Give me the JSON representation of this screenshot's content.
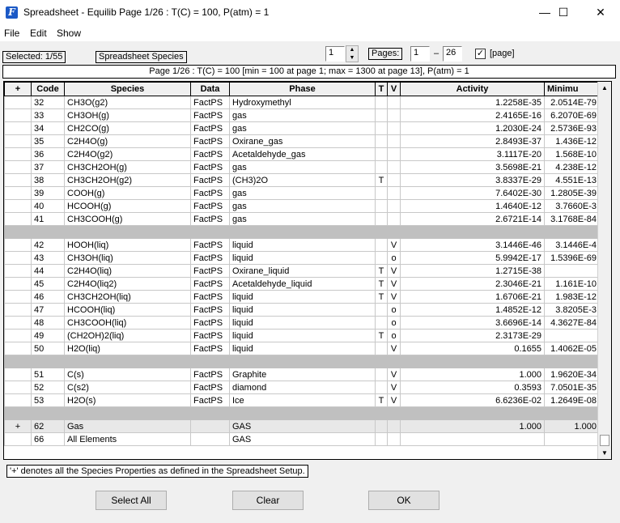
{
  "window": {
    "title": "Spreadsheet - Equilib   Page 1/26 : T(C) = 100,  P(atm) = 1",
    "minimize": "—",
    "maximize": "☐",
    "close": "✕"
  },
  "menu": [
    "File",
    "Edit",
    "Show"
  ],
  "toolbar": {
    "selected": "Selected: 1/55",
    "species_button": "Spreadsheet Species",
    "page_value": "1",
    "pages_label": "Pages:",
    "page_from": "1",
    "dash": "–",
    "page_to": "26",
    "page_check": "✓",
    "page_check_label": "[page]"
  },
  "info_bar": "Page 1/26 : T(C) = 100 [min = 100 at page  1; max = 1300 at page  13],  P(atm) = 1",
  "columns": [
    "+",
    "Code",
    "Species",
    "Data",
    "Phase",
    "T",
    "V",
    "Activity",
    "Minimu"
  ],
  "rows": [
    {
      "type": "row",
      "plus": "",
      "code": "32",
      "species": "CH3O(g2)",
      "data": "FactPS",
      "phase": "Hydroxymethyl",
      "t": "",
      "v": "",
      "activity": "1.2258E-35",
      "min": "2.0514E-79"
    },
    {
      "type": "row",
      "plus": "",
      "code": "33",
      "species": "CH3OH(g)",
      "data": "FactPS",
      "phase": "gas",
      "t": "",
      "v": "",
      "activity": "2.4165E-16",
      "min": "6.2070E-69"
    },
    {
      "type": "row",
      "plus": "",
      "code": "34",
      "species": "CH2CO(g)",
      "data": "FactPS",
      "phase": "gas",
      "t": "",
      "v": "",
      "activity": "1.2030E-24",
      "min": "2.5736E-93"
    },
    {
      "type": "row",
      "plus": "",
      "code": "35",
      "species": "C2H4O(g)",
      "data": "FactPS",
      "phase": "Oxirane_gas",
      "t": "",
      "v": "",
      "activity": "2.8493E-37",
      "min": "1.436E-12"
    },
    {
      "type": "row",
      "plus": "",
      "code": "36",
      "species": "C2H4O(g2)",
      "data": "FactPS",
      "phase": "Acetaldehyde_gas",
      "t": "",
      "v": "",
      "activity": "3.1117E-20",
      "min": "1.568E-10"
    },
    {
      "type": "row",
      "plus": "",
      "code": "37",
      "species": "CH3CH2OH(g)",
      "data": "FactPS",
      "phase": "gas",
      "t": "",
      "v": "",
      "activity": "3.5698E-21",
      "min": "4.238E-12"
    },
    {
      "type": "row",
      "plus": "",
      "code": "38",
      "species": "CH3CH2OH(g2)",
      "data": "FactPS",
      "phase": "(CH3)2O",
      "t": "T",
      "v": "",
      "activity": "3.8337E-29",
      "min": "4.551E-13"
    },
    {
      "type": "row",
      "plus": "",
      "code": "39",
      "species": "COOH(g)",
      "data": "FactPS",
      "phase": "gas",
      "t": "",
      "v": "",
      "activity": "7.6402E-30",
      "min": "1.2805E-39"
    },
    {
      "type": "row",
      "plus": "",
      "code": "40",
      "species": "HCOOH(g)",
      "data": "FactPS",
      "phase": "gas",
      "t": "",
      "v": "",
      "activity": "1.4640E-12",
      "min": "3.7660E-3"
    },
    {
      "type": "row",
      "plus": "",
      "code": "41",
      "species": "CH3COOH(g)",
      "data": "FactPS",
      "phase": "gas",
      "t": "",
      "v": "",
      "activity": "2.6721E-14",
      "min": "3.1768E-84"
    },
    {
      "type": "sep"
    },
    {
      "type": "row",
      "plus": "",
      "code": "42",
      "species": "HOOH(liq)",
      "data": "FactPS",
      "phase": "liquid",
      "t": "",
      "v": "V",
      "activity": "3.1446E-46",
      "min": "3.1446E-4"
    },
    {
      "type": "row",
      "plus": "",
      "code": "43",
      "species": "CH3OH(liq)",
      "data": "FactPS",
      "phase": "liquid",
      "t": "",
      "v": "o",
      "activity": "5.9942E-17",
      "min": "1.5396E-69"
    },
    {
      "type": "row",
      "plus": "",
      "code": "44",
      "species": "C2H4O(liq)",
      "data": "FactPS",
      "phase": "Oxirane_liquid",
      "t": "T",
      "v": "V",
      "activity": "1.2715E-38",
      "min": ""
    },
    {
      "type": "row",
      "plus": "",
      "code": "45",
      "species": "C2H4O(liq2)",
      "data": "FactPS",
      "phase": "Acetaldehyde_liquid",
      "t": "T",
      "v": "V",
      "activity": "2.3046E-21",
      "min": "1.161E-10"
    },
    {
      "type": "row",
      "plus": "",
      "code": "46",
      "species": "CH3CH2OH(liq)",
      "data": "FactPS",
      "phase": "liquid",
      "t": "T",
      "v": "V",
      "activity": "1.6706E-21",
      "min": "1.983E-12"
    },
    {
      "type": "row",
      "plus": "",
      "code": "47",
      "species": "HCOOH(liq)",
      "data": "FactPS",
      "phase": "liquid",
      "t": "",
      "v": "o",
      "activity": "1.4852E-12",
      "min": "3.8205E-3"
    },
    {
      "type": "row",
      "plus": "",
      "code": "48",
      "species": "CH3COOH(liq)",
      "data": "FactPS",
      "phase": "liquid",
      "t": "",
      "v": "o",
      "activity": "3.6696E-14",
      "min": "4.3627E-84"
    },
    {
      "type": "row",
      "plus": "",
      "code": "49",
      "species": "(CH2OH)2(liq)",
      "data": "FactPS",
      "phase": "liquid",
      "t": "T",
      "v": "o",
      "activity": "2.3173E-29",
      "min": ""
    },
    {
      "type": "row",
      "plus": "",
      "code": "50",
      "species": "H2O(liq)",
      "data": "FactPS",
      "phase": "liquid",
      "t": "",
      "v": "V",
      "activity": "0.1655",
      "min": "1.4062E-05"
    },
    {
      "type": "sep"
    },
    {
      "type": "row",
      "plus": "",
      "code": "51",
      "species": "C(s)",
      "data": "FactPS",
      "phase": "Graphite",
      "t": "",
      "v": "V",
      "activity": "1.000",
      "min": "1.9620E-34"
    },
    {
      "type": "row",
      "plus": "",
      "code": "52",
      "species": "C(s2)",
      "data": "FactPS",
      "phase": "diamond",
      "t": "",
      "v": "V",
      "activity": "0.3593",
      "min": "7.0501E-35"
    },
    {
      "type": "row",
      "plus": "",
      "code": "53",
      "species": "H2O(s)",
      "data": "FactPS",
      "phase": "Ice",
      "t": "T",
      "v": "V",
      "activity": "6.6236E-02",
      "min": "1.2649E-08"
    },
    {
      "type": "sep"
    },
    {
      "type": "gas",
      "plus": "+",
      "code": "62",
      "species": "Gas",
      "data": "",
      "phase": "GAS",
      "t": "",
      "v": "",
      "activity": "1.000",
      "min": "1.000"
    },
    {
      "type": "row",
      "plus": "",
      "code": "66",
      "species": "All Elements",
      "data": "",
      "phase": "GAS",
      "t": "",
      "v": "",
      "activity": "",
      "min": ""
    }
  ],
  "footnote": "'+' denotes all the Species Properties as defined in the Spreadsheet Setup.",
  "buttons": {
    "select_all": "Select All",
    "clear": "Clear",
    "ok": "OK"
  }
}
